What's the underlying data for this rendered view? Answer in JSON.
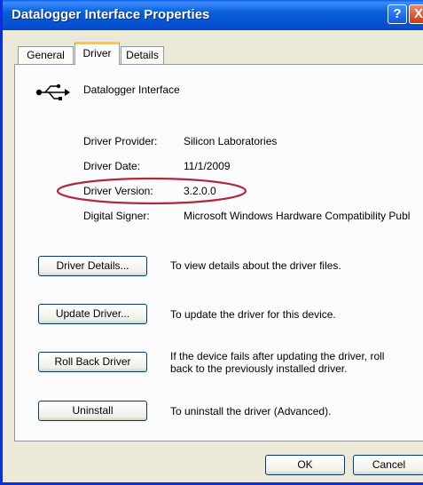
{
  "window": {
    "title": "Datalogger Interface Properties",
    "help_glyph": "?",
    "close_glyph": "X"
  },
  "tabs": [
    {
      "label": "General",
      "active": false
    },
    {
      "label": "Driver",
      "active": true
    },
    {
      "label": "Details",
      "active": false
    }
  ],
  "device": {
    "icon": "usb-icon",
    "name": "Datalogger Interface"
  },
  "driver_info": [
    {
      "label": "Driver Provider:",
      "value": "Silicon Laboratories"
    },
    {
      "label": "Driver Date:",
      "value": "11/1/2009"
    },
    {
      "label": "Driver Version:",
      "value": "3.2.0.0"
    },
    {
      "label": "Digital Signer:",
      "value": "Microsoft Windows Hardware Compatibility Publ"
    }
  ],
  "actions": [
    {
      "button": "Driver Details...",
      "description": "To view details about the driver files."
    },
    {
      "button": "Update Driver...",
      "description": "To update the driver for this device."
    },
    {
      "button": "Roll Back Driver",
      "description": "If the device fails after updating the driver, roll back to the previously installed driver."
    },
    {
      "button": "Uninstall",
      "description": "To uninstall the driver (Advanced)."
    }
  ],
  "footer": {
    "ok_label": "OK",
    "cancel_label": "Cancel"
  },
  "colors": {
    "titlebar": "#0a5fd8",
    "highlight_ellipse": "#b0283a",
    "active_tab_accent": "#ffc83c"
  }
}
